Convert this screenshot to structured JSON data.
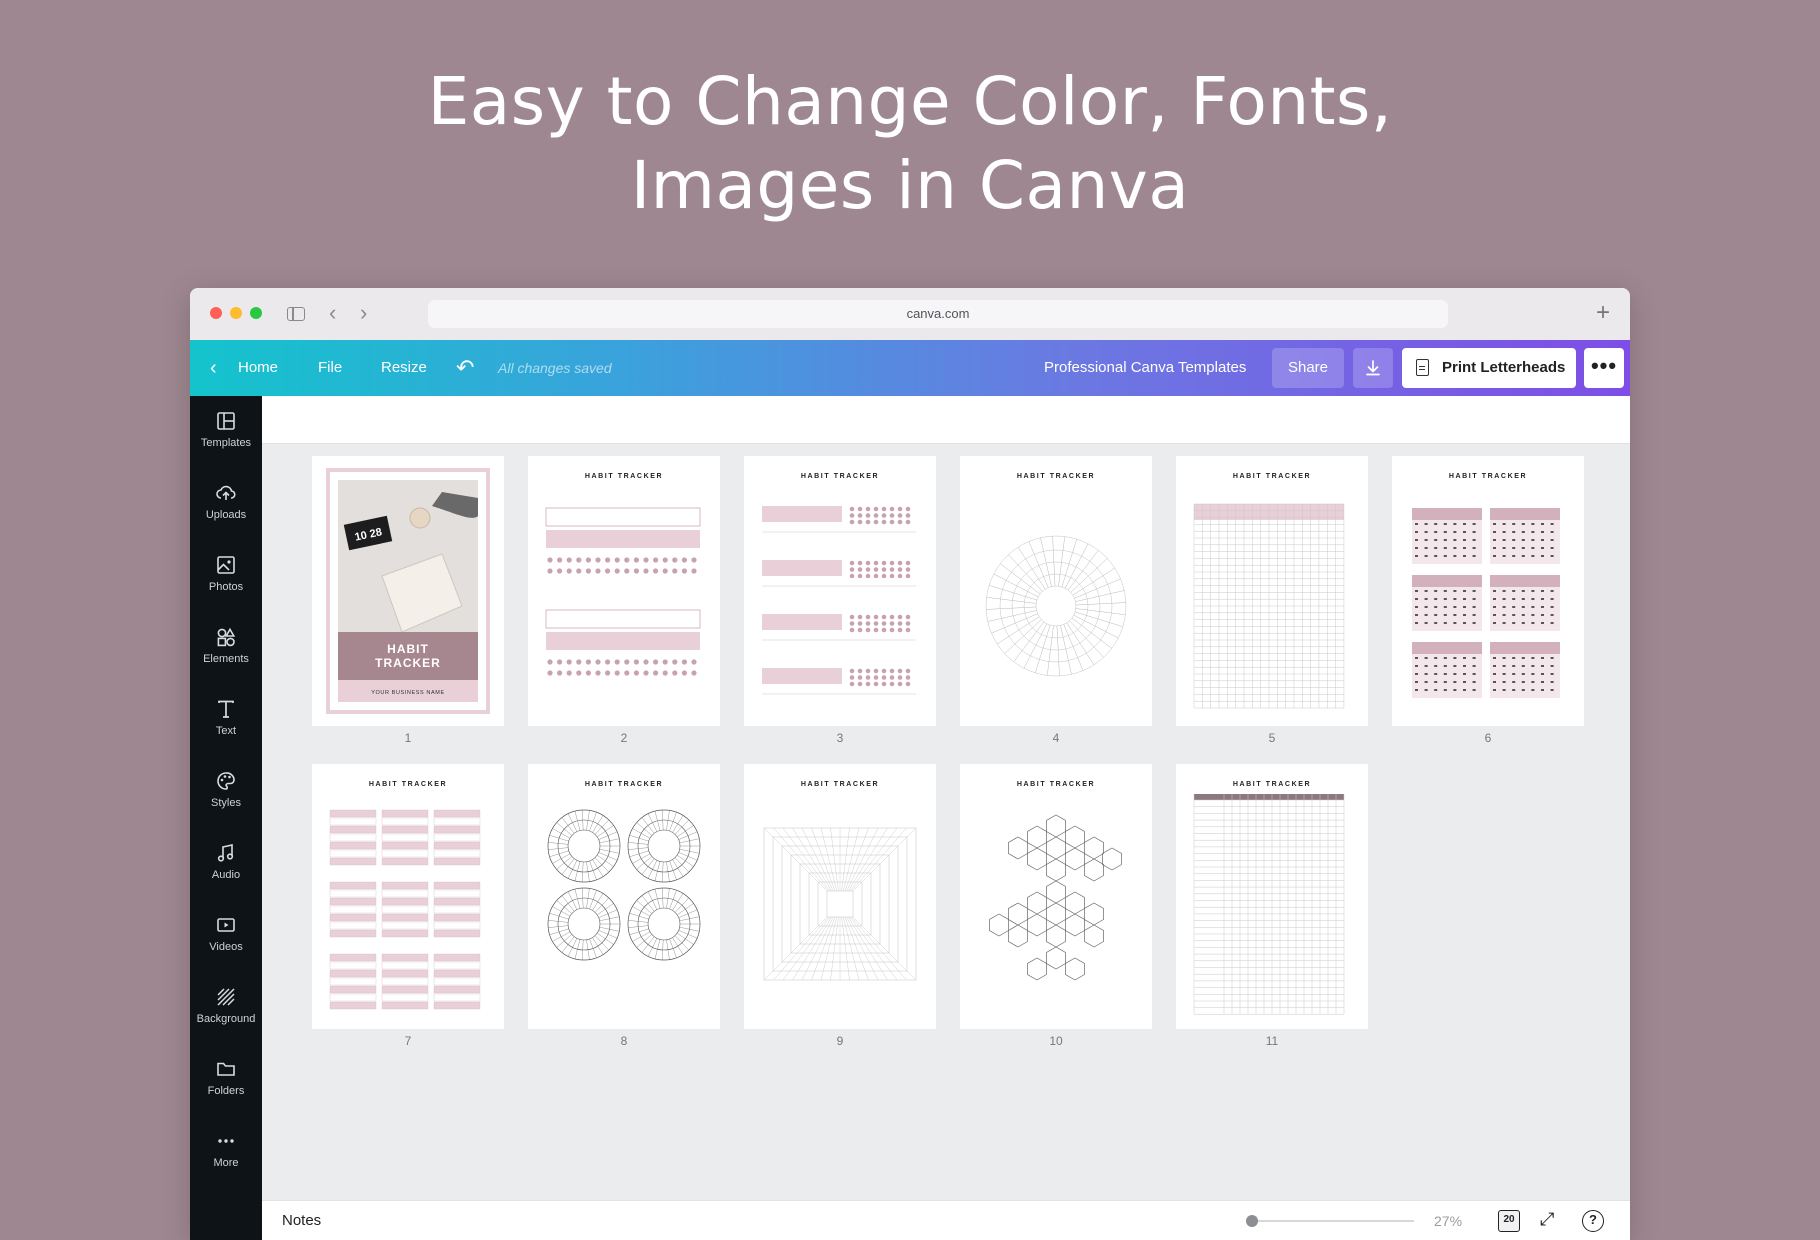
{
  "headline": {
    "line1": "Easy to Change Color, Fonts,",
    "line2": "Images in Canva"
  },
  "browser": {
    "url": "canva.com"
  },
  "toolbar": {
    "home": "Home",
    "file": "File",
    "resize": "Resize",
    "status": "All changes saved",
    "project_title": "Professional Canva Templates",
    "share": "Share",
    "print": "Print Letterheads"
  },
  "sidebar": {
    "items": [
      {
        "label": "Templates",
        "icon": "templates-icon"
      },
      {
        "label": "Uploads",
        "icon": "uploads-icon"
      },
      {
        "label": "Photos",
        "icon": "photos-icon"
      },
      {
        "label": "Elements",
        "icon": "elements-icon"
      },
      {
        "label": "Text",
        "icon": "text-icon"
      },
      {
        "label": "Styles",
        "icon": "styles-icon"
      },
      {
        "label": "Audio",
        "icon": "audio-icon"
      },
      {
        "label": "Videos",
        "icon": "videos-icon"
      },
      {
        "label": "Background",
        "icon": "background-icon"
      },
      {
        "label": "Folders",
        "icon": "folders-icon"
      },
      {
        "label": "More",
        "icon": "more-icon"
      }
    ]
  },
  "pages": [
    {
      "number": "1",
      "cover_title_1": "HABIT",
      "cover_title_2": "TRACKER",
      "cover_sub": "YOUR BUSINESS NAME",
      "photo_time": "10 28"
    },
    {
      "number": "2",
      "title": "HABIT TRACKER"
    },
    {
      "number": "3",
      "title": "HABIT TRACKER"
    },
    {
      "number": "4",
      "title": "HABIT TRACKER"
    },
    {
      "number": "5",
      "title": "HABIT TRACKER"
    },
    {
      "number": "6",
      "title": "HABIT TRACKER"
    },
    {
      "number": "7",
      "title": "HABIT TRACKER"
    },
    {
      "number": "8",
      "title": "HABIT TRACKER"
    },
    {
      "number": "9",
      "title": "HABIT TRACKER"
    },
    {
      "number": "10",
      "title": "HABIT TRACKER"
    },
    {
      "number": "11",
      "title": "HABIT TRACKER"
    }
  ],
  "bottombar": {
    "notes": "Notes",
    "zoom": "27%",
    "page_count": "20"
  },
  "colors": {
    "accent_pink": "#e8cfd8",
    "cover_mauve": "#a7878f",
    "sidebar_bg": "#0e1318"
  }
}
